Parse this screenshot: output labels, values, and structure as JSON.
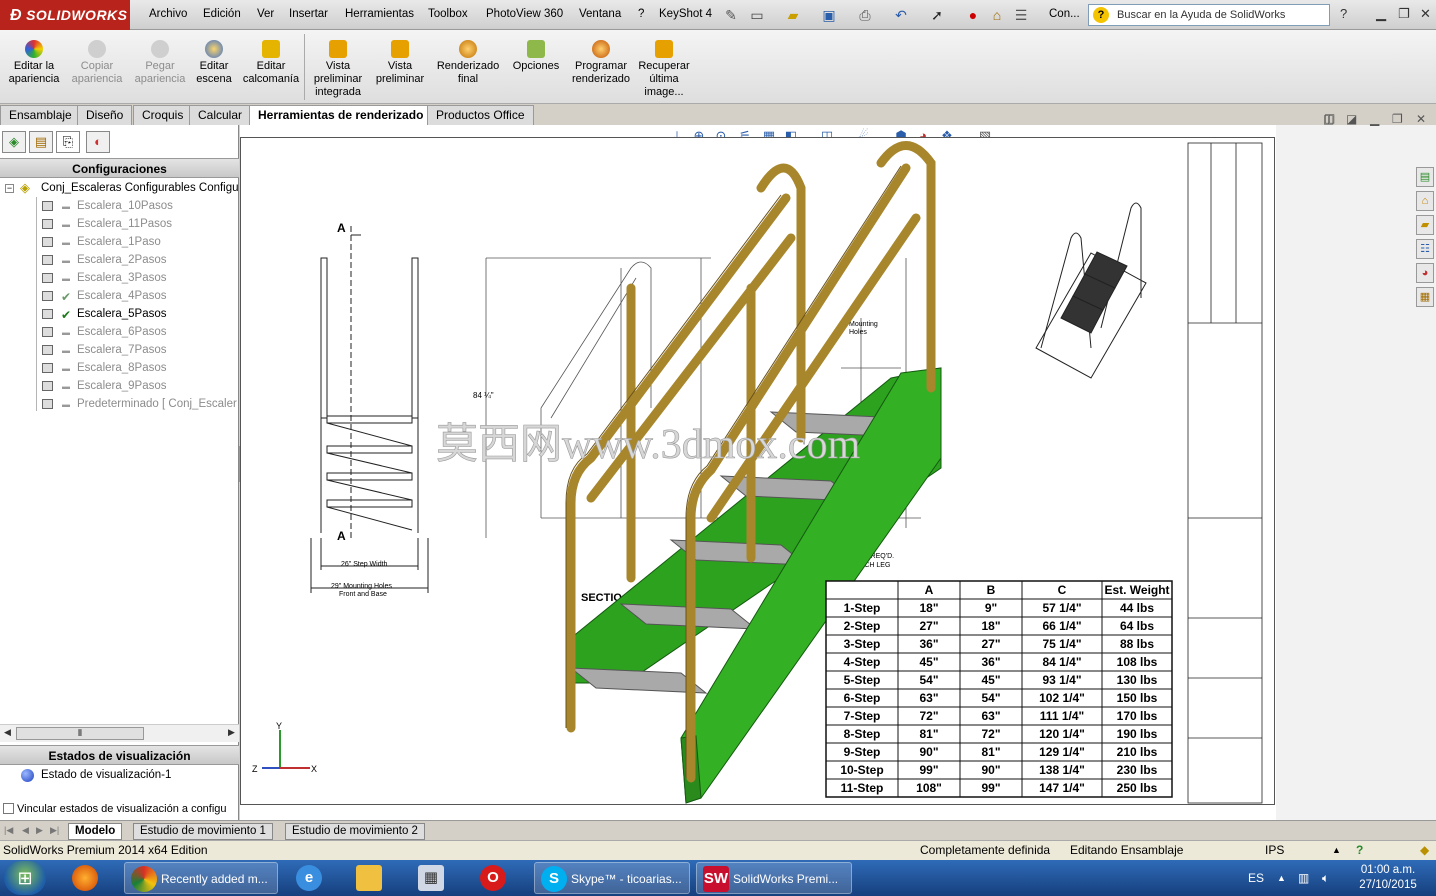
{
  "app": {
    "logo": "SOLIDWORKS"
  },
  "menu": [
    "Archivo",
    "Edición",
    "Ver",
    "Insertar",
    "Herramientas",
    "Toolbox",
    "PhotoView 360",
    "Ventana",
    "?",
    "KeyShot 4"
  ],
  "toolbar": {
    "config_label": "Con...",
    "help_placeholder": "Buscar en la Ayuda de SolidWorks"
  },
  "command_manager": [
    {
      "label": "Editar la apariencia",
      "enabled": true
    },
    {
      "label": "Copiar apariencia",
      "enabled": false
    },
    {
      "label": "Pegar apariencia",
      "enabled": false
    },
    {
      "label": "Editar escena",
      "enabled": true
    },
    {
      "label": "Editar calcomanía",
      "enabled": true
    },
    {
      "label": "Vista preliminar integrada",
      "enabled": true
    },
    {
      "label": "Vista preliminar",
      "enabled": true
    },
    {
      "label": "Renderizado final",
      "enabled": true
    },
    {
      "label": "Opciones",
      "enabled": true
    },
    {
      "label": "Programar renderizado",
      "enabled": true
    },
    {
      "label": "Recuperar última image...",
      "enabled": true
    }
  ],
  "tabs": [
    "Ensamblaje",
    "Diseño",
    "Croquis",
    "Calcular",
    "Herramientas de renderizado",
    "Productos Office"
  ],
  "active_tab": "Herramientas de renderizado",
  "left_panel": {
    "configurations_header": "Configuraciones",
    "root": "Conj_Escaleras Configurables Configu",
    "configs": [
      {
        "name": "Escalera_10Pasos",
        "checked": false,
        "active": false
      },
      {
        "name": "Escalera_11Pasos",
        "checked": false,
        "active": false
      },
      {
        "name": "Escalera_1Paso",
        "checked": false,
        "active": false
      },
      {
        "name": "Escalera_2Pasos",
        "checked": false,
        "active": false
      },
      {
        "name": "Escalera_3Pasos",
        "checked": false,
        "active": false
      },
      {
        "name": "Escalera_4Pasos",
        "checked": true,
        "active": false
      },
      {
        "name": "Escalera_5Pasos",
        "checked": true,
        "active": true
      },
      {
        "name": "Escalera_6Pasos",
        "checked": false,
        "active": false
      },
      {
        "name": "Escalera_7Pasos",
        "checked": false,
        "active": false
      },
      {
        "name": "Escalera_8Pasos",
        "checked": false,
        "active": false
      },
      {
        "name": "Escalera_9Pasos",
        "checked": false,
        "active": false
      },
      {
        "name": "Predeterminado [ Conj_Escaler",
        "checked": false,
        "active": false
      }
    ],
    "display_states_header": "Estados de visualización",
    "display_state": "Estado de visualización-1",
    "link_checkbox": "Vincular estados de visualización a configu"
  },
  "drawing": {
    "label_a": "A",
    "dim_width": "26\" Step Width",
    "dim_mount1": "29\" Mounting Holes",
    "dim_mount2": "Front and Base",
    "mounting_holes": "Mounting\nHoles",
    "height_dim": "84 ¼\"",
    "section": "SECTIO",
    "bolt_note": "BOLT REQ'D.\nEACH LEG",
    "watermark": "莫西网www.3dmox.com",
    "table_headers": [
      "",
      "A",
      "B",
      "C",
      "Est. Weight"
    ],
    "table_rows": [
      [
        "1-Step",
        "18\"",
        "9\"",
        "57 1/4\"",
        "44 lbs"
      ],
      [
        "2-Step",
        "27\"",
        "18\"",
        "66 1/4\"",
        "64 lbs"
      ],
      [
        "3-Step",
        "36\"",
        "27\"",
        "75 1/4\"",
        "88 lbs"
      ],
      [
        "4-Step",
        "45\"",
        "36\"",
        "84 1/4\"",
        "108 lbs"
      ],
      [
        "5-Step",
        "54\"",
        "45\"",
        "93 1/4\"",
        "130 lbs"
      ],
      [
        "6-Step",
        "63\"",
        "54\"",
        "102 1/4\"",
        "150 lbs"
      ],
      [
        "7-Step",
        "72\"",
        "63\"",
        "111 1/4\"",
        "170 lbs"
      ],
      [
        "8-Step",
        "81\"",
        "72\"",
        "120 1/4\"",
        "190 lbs"
      ],
      [
        "9-Step",
        "90\"",
        "81\"",
        "129 1/4\"",
        "210 lbs"
      ],
      [
        "10-Step",
        "99\"",
        "90\"",
        "138 1/4\"",
        "230 lbs"
      ],
      [
        "11-Step",
        "108\"",
        "99\"",
        "147 1/4\"",
        "250 lbs"
      ]
    ],
    "colors": {
      "stringer": "#2ca21e",
      "handrail": "#a7862c",
      "tread": "#a9a9a9"
    }
  },
  "bottom_tabs": [
    "Modelo",
    "Estudio de movimiento 1",
    "Estudio de movimiento 2"
  ],
  "status": {
    "edition": "SolidWorks Premium 2014 x64 Edition",
    "definition": "Completamente definida",
    "mode": "Editando Ensamblaje",
    "units": "IPS"
  },
  "taskbar": {
    "items": [
      {
        "label": "",
        "icon": "firefox-icon"
      },
      {
        "label": "Recently added m...",
        "icon": "chrome-icon"
      },
      {
        "label": "",
        "icon": "ie-icon"
      },
      {
        "label": "",
        "icon": "explorer-icon"
      },
      {
        "label": "",
        "icon": "calculator-icon"
      },
      {
        "label": "",
        "icon": "opera-icon"
      },
      {
        "label": "Skype™ - ticoarias...",
        "icon": "skype-icon"
      },
      {
        "label": "SolidWorks Premi...",
        "icon": "solidworks-icon"
      }
    ],
    "lang": "ES",
    "time": "01:00 a.m.",
    "date": "27/10/2015"
  }
}
